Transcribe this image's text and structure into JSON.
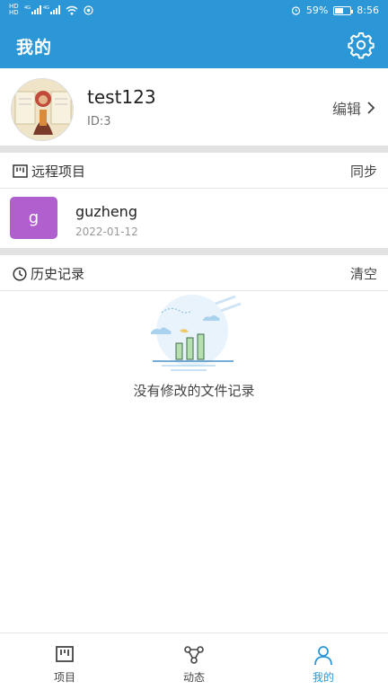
{
  "status_bar": {
    "network_left": "HD",
    "signal_label": "4G",
    "battery_pct": "59%",
    "battery_level": 0.59,
    "time": "8:56"
  },
  "header": {
    "title": "我的",
    "settings_icon": "gear-icon"
  },
  "profile": {
    "username": "test123",
    "user_id": "ID:3",
    "edit_label": "编辑"
  },
  "remote_projects": {
    "title": "远程项目",
    "action": "同步",
    "items": [
      {
        "badge": "g",
        "name": "guzheng",
        "date": "2022-01-12",
        "badge_color": "#b05fcf"
      }
    ]
  },
  "history": {
    "title": "历史记录",
    "action": "清空",
    "empty_text": "没有修改的文件记录"
  },
  "tabbar": {
    "tabs": [
      {
        "label": "项目",
        "icon": "project-board-icon"
      },
      {
        "label": "动态",
        "icon": "network-nodes-icon"
      },
      {
        "label": "我的",
        "icon": "person-icon"
      }
    ],
    "active": "我的",
    "accent": "#2b97d6"
  }
}
